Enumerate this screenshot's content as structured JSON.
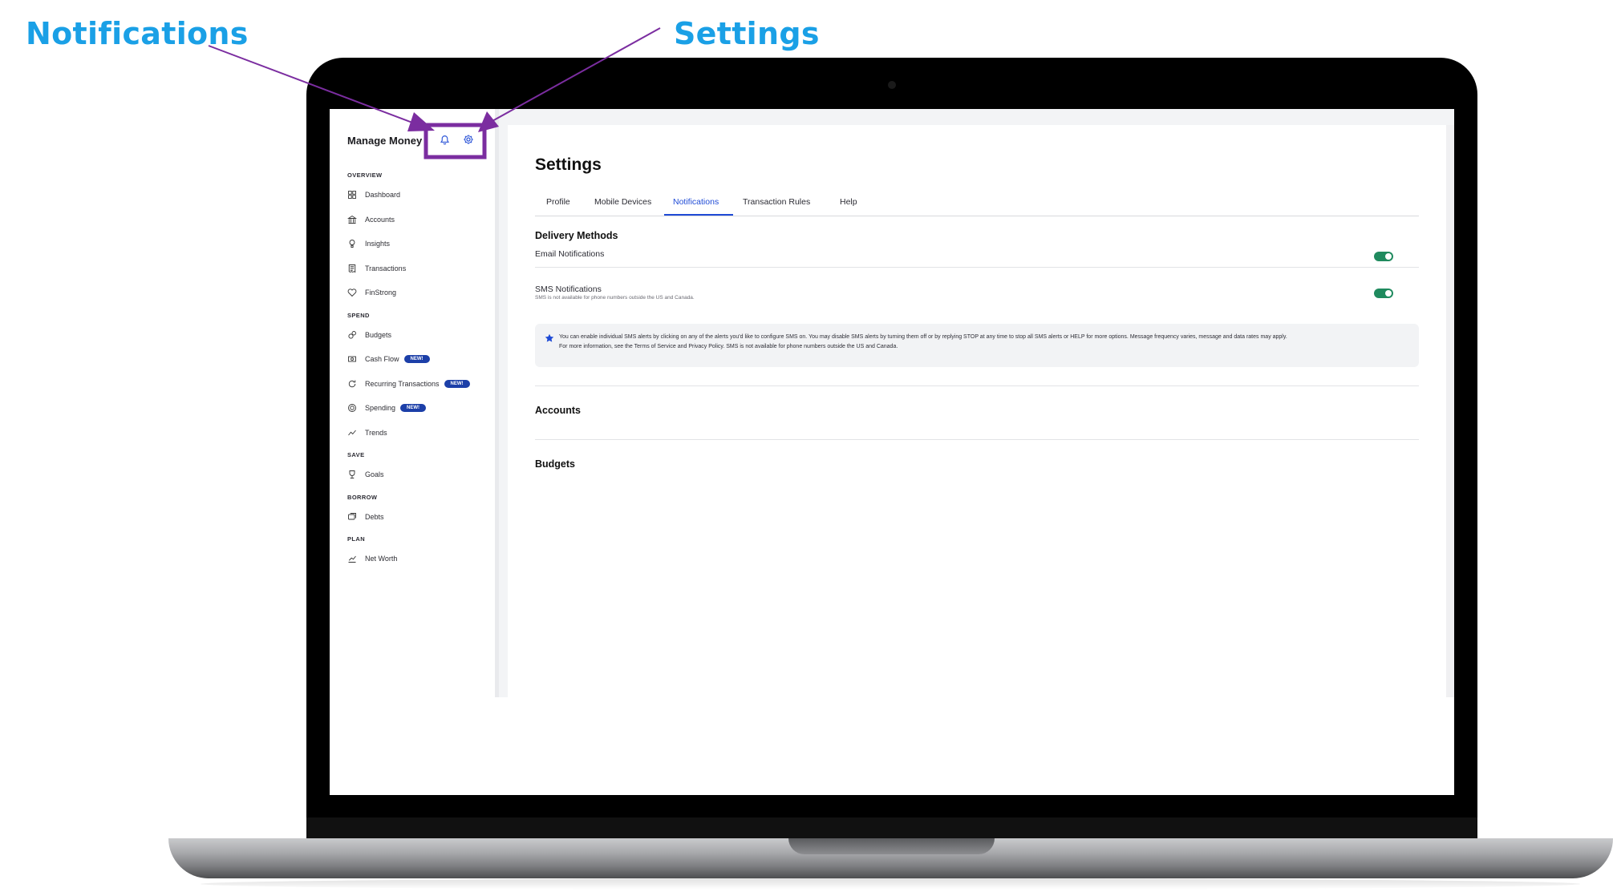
{
  "callouts": {
    "notifications": "Notifications",
    "settings": "Settings"
  },
  "colors": {
    "accent": "#1f4bd6",
    "callout": "#1aa0e6",
    "arrow": "#7b2da0",
    "toggle_on": "#1f8a5e",
    "badge": "#1c3fa8"
  },
  "sidebar": {
    "brand": "Manage Money",
    "icons": {
      "notifications": "bell-icon",
      "settings": "gear-icon"
    },
    "sections": [
      {
        "title": "OVERVIEW",
        "items": [
          {
            "label": "Dashboard",
            "icon": "grid-icon"
          },
          {
            "label": "Accounts",
            "icon": "bank-icon"
          },
          {
            "label": "Insights",
            "icon": "lightbulb-icon"
          },
          {
            "label": "Transactions",
            "icon": "receipt-icon"
          },
          {
            "label": "FinStrong",
            "icon": "heart-icon"
          }
        ]
      },
      {
        "title": "SPEND",
        "items": [
          {
            "label": "Budgets",
            "icon": "coins-icon"
          },
          {
            "label": "Cash Flow",
            "icon": "cashflow-icon",
            "badge": "NEW!"
          },
          {
            "label": "Recurring Transactions",
            "icon": "recurring-icon",
            "badge": "NEW!"
          },
          {
            "label": "Spending",
            "icon": "spending-icon",
            "badge": "NEW!"
          },
          {
            "label": "Trends",
            "icon": "trends-icon"
          }
        ]
      },
      {
        "title": "SAVE",
        "items": [
          {
            "label": "Goals",
            "icon": "trophy-icon"
          }
        ]
      },
      {
        "title": "BORROW",
        "items": [
          {
            "label": "Debts",
            "icon": "debts-icon"
          }
        ]
      },
      {
        "title": "PLAN",
        "items": [
          {
            "label": "Net Worth",
            "icon": "chart-icon"
          }
        ]
      }
    ]
  },
  "main": {
    "title": "Settings",
    "tabs": [
      {
        "label": "Profile",
        "active": false
      },
      {
        "label": "Mobile Devices",
        "active": false
      },
      {
        "label": "Notifications",
        "active": true
      },
      {
        "label": "Transaction Rules",
        "active": false
      },
      {
        "label": "Help",
        "active": false
      }
    ],
    "delivery": {
      "heading": "Delivery Methods",
      "email": {
        "label": "Email Notifications",
        "enabled": true
      },
      "sms": {
        "label": "SMS Notifications",
        "sub": "SMS is not available for phone numbers outside the US and Canada.",
        "enabled": true
      }
    },
    "info_line1": "You can enable individual SMS alerts by clicking on any of the alerts you'd like to configure SMS on. You may disable SMS alerts by turning them off or by replying STOP at any time to stop all SMS alerts or HELP for more options. Message frequency varies, message and data rates may apply.",
    "info_line2": "For more information, see the Terms of Service and Privacy Policy. SMS is not available for phone numbers outside the US and Canada.",
    "accounts_heading": "Accounts",
    "budgets_heading": "Budgets"
  }
}
